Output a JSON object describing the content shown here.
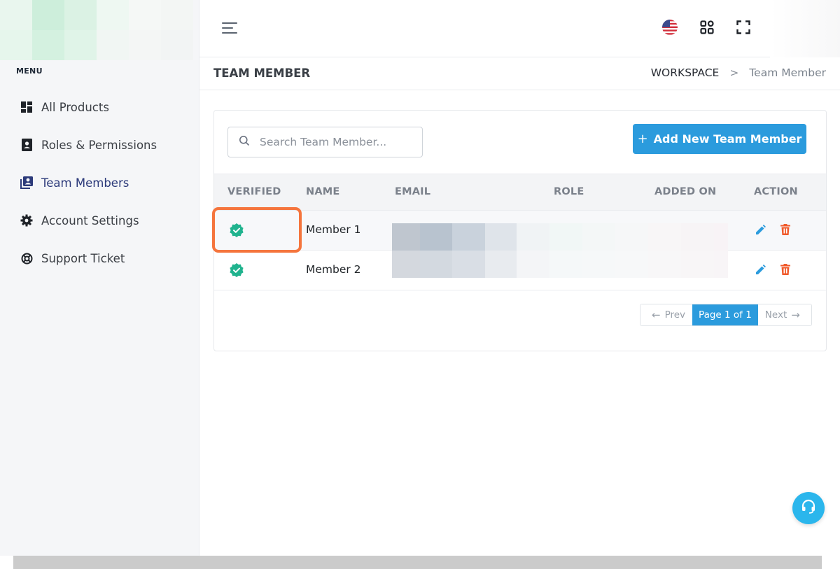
{
  "sidebar": {
    "menu_title": "MENU",
    "items": [
      {
        "label": "All Products",
        "icon": "dashboard-icon"
      },
      {
        "label": "Roles & Permissions",
        "icon": "id-badge-icon"
      },
      {
        "label": "Team Members",
        "icon": "team-members-icon",
        "active": true
      },
      {
        "label": "Account Settings",
        "icon": "gear-icon"
      },
      {
        "label": "Support Ticket",
        "icon": "lifebuoy-icon"
      }
    ]
  },
  "topbar": {
    "icons": [
      "menu-icon",
      "us-flag-icon",
      "apps-grid-icon",
      "fullscreen-icon"
    ]
  },
  "page": {
    "title": "TEAM MEMBER",
    "breadcrumb": [
      "WORKSPACE",
      "Team Member"
    ],
    "breadcrumb_separator": ">"
  },
  "toolbar": {
    "search_placeholder": "Search Team Member...",
    "add_button_label": "Add New Team Member",
    "add_button_plus": "+"
  },
  "table": {
    "columns": [
      "VERIFIED",
      "NAME",
      "EMAIL",
      "ROLE",
      "ADDED ON",
      "ACTION"
    ],
    "rows": [
      {
        "verified": true,
        "name": "Member 1"
      },
      {
        "verified": true,
        "name": "Member 2"
      }
    ]
  },
  "pagination": {
    "prev_label": "Prev",
    "prev_arrow": "←",
    "current_label": "Page 1 of 1",
    "next_label": "Next",
    "next_arrow": "→"
  },
  "colors": {
    "accent": "#2b9bdd",
    "verified": "#20b38e",
    "edit": "#2b9bdd",
    "delete": "#f05a2b",
    "highlight": "#f5753d",
    "support": "#2bb6ec"
  }
}
